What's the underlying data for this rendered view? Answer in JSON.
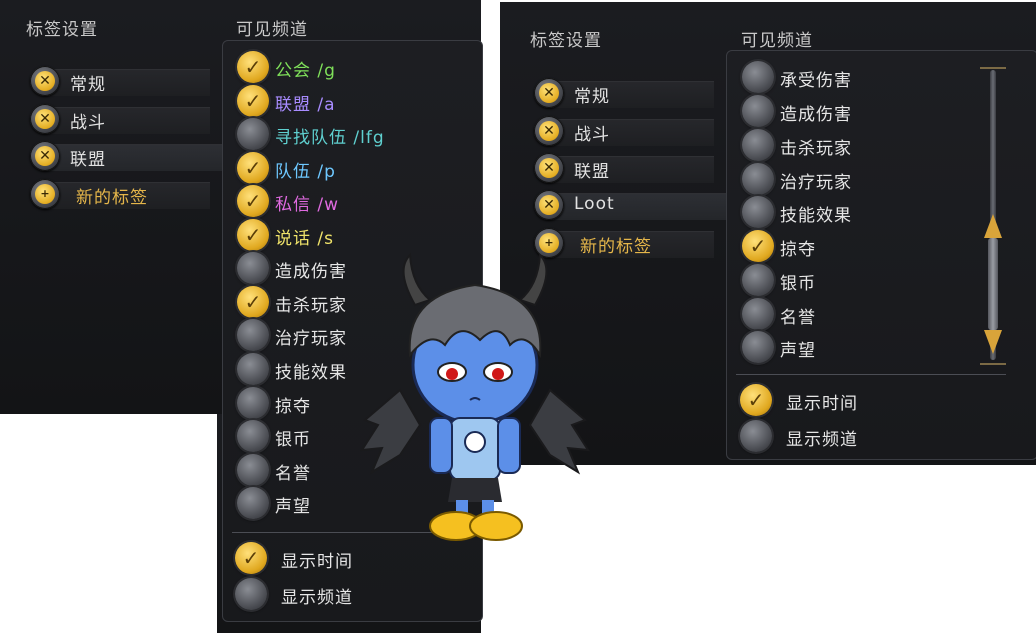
{
  "colors": {
    "guild": "#7fe05a",
    "alliance": "#a88cff",
    "lfg": "#5fd0d0",
    "party": "#6ec8ff",
    "whisper": "#e06ae0",
    "say": "#f0e36a",
    "gold": "#e5b64a"
  },
  "left": {
    "tab_heading": "标签设置",
    "channel_heading": "可见频道",
    "tabs": [
      {
        "label": "常规",
        "icon": "close-icon"
      },
      {
        "label": "战斗",
        "icon": "close-icon"
      },
      {
        "label": "联盟",
        "icon": "close-icon"
      },
      {
        "label": "新的标签",
        "icon": "plus-icon"
      }
    ],
    "channels": [
      {
        "label": "公会 /g",
        "checked": true
      },
      {
        "label": "联盟 /a",
        "checked": true
      },
      {
        "label": "寻找队伍 /lfg",
        "checked": false
      },
      {
        "label": "队伍 /p",
        "checked": true
      },
      {
        "label": "私信 /w",
        "checked": true
      },
      {
        "label": "说话 /s",
        "checked": true
      },
      {
        "label": "造成伤害",
        "checked": false
      },
      {
        "label": "击杀玩家",
        "checked": true
      },
      {
        "label": "治疗玩家",
        "checked": false
      },
      {
        "label": "技能效果",
        "checked": false
      },
      {
        "label": "掠夺",
        "checked": false
      },
      {
        "label": "银币",
        "checked": false
      },
      {
        "label": "名誉",
        "checked": false
      },
      {
        "label": "声望",
        "checked": false
      }
    ],
    "options": [
      {
        "label": "显示时间",
        "checked": true
      },
      {
        "label": "显示频道",
        "checked": false
      }
    ]
  },
  "right": {
    "tab_heading": "标签设置",
    "channel_heading": "可见频道",
    "tabs": [
      {
        "label": "常规",
        "icon": "close-icon"
      },
      {
        "label": "战斗",
        "icon": "close-icon"
      },
      {
        "label": "联盟",
        "icon": "close-icon"
      },
      {
        "label": "Loot",
        "icon": "close-icon"
      },
      {
        "label": "新的标签",
        "icon": "plus-icon"
      }
    ],
    "channels": [
      {
        "label": "承受伤害",
        "checked": false
      },
      {
        "label": "造成伤害",
        "checked": false
      },
      {
        "label": "击杀玩家",
        "checked": false
      },
      {
        "label": "治疗玩家",
        "checked": false
      },
      {
        "label": "技能效果",
        "checked": false
      },
      {
        "label": "掠夺",
        "checked": true
      },
      {
        "label": "银币",
        "checked": false
      },
      {
        "label": "名誉",
        "checked": false
      },
      {
        "label": "声望",
        "checked": false
      }
    ],
    "options": [
      {
        "label": "显示时间",
        "checked": true
      },
      {
        "label": "显示频道",
        "checked": false
      }
    ]
  }
}
